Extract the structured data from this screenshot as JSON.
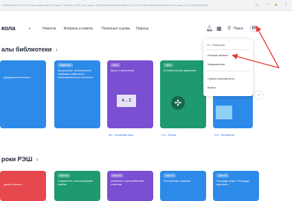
{
  "browser": {
    "url": "3b8f9a11c51b-47c4-b2ea-a9d8ed8f2b1a1aaa-7f2b5a0c-a2f6-4cfa-aa0c-d2a91ca7ad5a58f9d5d8-b1cf-4c19-b23b-ad8f4b2a6ad2f0-a4fb-46aa-a77a-7af2414001b"
  },
  "nav": {
    "logo": "кола",
    "links": [
      "Новости",
      "Вопросы и ответы",
      "Полезные ссылки",
      "Опросы"
    ],
    "search_label": "Поиск",
    "avatar_initials": "ЕК"
  },
  "sections": {
    "library_title": "алы библиотеки",
    "resh_title": "роки РЭШ"
  },
  "library_cards": [
    {
      "badge": "",
      "title": "цифрового ательного",
      "color": "#2e8ae8"
    },
    {
      "badge": "Подборка",
      "title": "Актуальные тематические подборки цифрового образовательного контента",
      "color": "#2e8ae8"
    },
    {
      "badge": "Урок",
      "title": "Досуг и увлечения",
      "color": "#7a4fd1"
    },
    {
      "badge": "Урок",
      "title": "Колебательное движение",
      "color": "#1f9a6e"
    },
    {
      "badge": "",
      "title": "",
      "color": "#2e8ae8"
    }
  ],
  "card_tags": [
    {
      "grade": "8кл",
      "subject": "Английский язык"
    },
    {
      "grade": "9 кл",
      "subject": "Физика"
    },
    {
      "grade": "6 кл",
      "subject": "Математика"
    }
  ],
  "resh_cards": [
    {
      "badge": "",
      "title": "хорзо клоунко —",
      "color": "#e5484d"
    },
    {
      "badge": "Урок 12",
      "title": "Отражение и многообразие гербов",
      "color": "#1f9a6e"
    },
    {
      "badge": "Урок 57",
      "title": "Значение и употребление глаголов",
      "color": "#7a4fd1"
    },
    {
      "badge": "Урок 11",
      "title": "Построение графика",
      "color": "#2e8ae8"
    },
    {
      "badge": "Урок 24",
      "title": "Площадь круга. Площадь кругового",
      "color": "#2e8ae8"
    }
  ],
  "menu": {
    "user_name": "Е... Рабчиева",
    "items": [
      "Личный кабинет",
      "Уведомления",
      "Смена пользователя",
      "Выйти"
    ]
  },
  "icons": {
    "bell": "bell-icon",
    "grid": "grid-icon",
    "search": "search-icon",
    "arrow_next": "arrow-right-icon"
  },
  "annotation": {
    "arrow_color": "#e53935"
  }
}
